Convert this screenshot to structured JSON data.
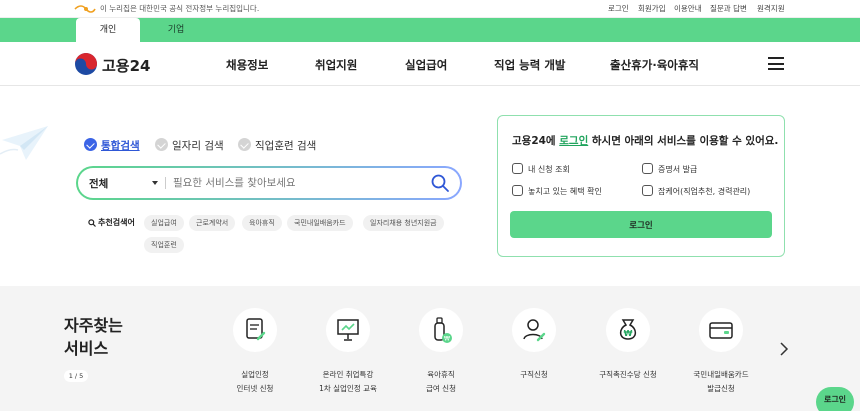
{
  "govbar": {
    "notice": "이 누리집은 대한민국 공식 전자정부 누리집입니다.",
    "links": [
      "로그인",
      "회원가입",
      "이용안내",
      "질문과 답변",
      "원격지원"
    ]
  },
  "tabs": {
    "personal": "개인",
    "company": "기업"
  },
  "header": {
    "brand": "고용24",
    "nav": [
      "채용정보",
      "취업지원",
      "실업급여",
      "직업 능력 개발",
      "출산휴가·육아휴직"
    ]
  },
  "search": {
    "scopes": [
      "통합검색",
      "일자리 검색",
      "직업훈련 검색"
    ],
    "category": "전체",
    "placeholder": "필요한 서비스를 찾아보세요",
    "recommend_title": "추천검색어",
    "keywords": [
      "실업급여",
      "근로계약서",
      "육아휴직",
      "국민내일배움카드",
      "일자리채용 청년지원금",
      "직업훈련"
    ]
  },
  "login_card": {
    "title_pre": "고용24에 ",
    "title_hl": "로그인",
    "title_post": " 하시면 아래의 서비스를 이용할 수 있어요.",
    "services": [
      "내 신청 조회",
      "증명서 발급",
      "놓치고 있는 혜택 확인",
      "잡케어(직업추천, 경력관리)"
    ],
    "button": "로그인"
  },
  "frequent": {
    "title_line1": "자주찾는",
    "title_line2": "서비스",
    "pager": "1 / 5",
    "items": [
      {
        "line1": "실업인정",
        "line2": "인터넷 신청",
        "icon": "document-edit-icon"
      },
      {
        "line1": "온라인 취업특강",
        "line2": "1차 실업인정 교육",
        "icon": "presentation-board-icon"
      },
      {
        "line1": "육아휴직",
        "line2": "급여 신청",
        "icon": "baby-bottle-icon"
      },
      {
        "line1": "구직신청",
        "line2": "",
        "icon": "person-edit-icon"
      },
      {
        "line1": "구직촉진수당 신청",
        "line2": "",
        "icon": "money-bag-icon"
      },
      {
        "line1": "국민내일배움카드",
        "line2": "발급신청",
        "icon": "card-icon"
      }
    ],
    "float_login": "로그인"
  },
  "colors": {
    "accent_green": "#5bd68b",
    "accent_blue": "#3b64e6"
  }
}
